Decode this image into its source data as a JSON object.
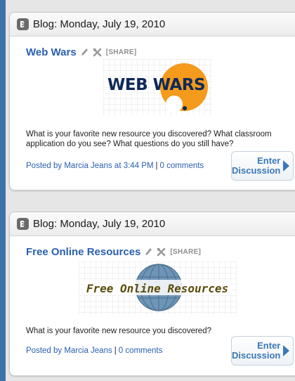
{
  "posts": [
    {
      "header": "Blog: Monday, July 19, 2010",
      "title": "Web Wars",
      "share_label": "[SHARE]",
      "logo_text": "WEB WARS",
      "body": "What is your favorite new resource you discovered? What classroom application do you see? What questions do you still have?",
      "footer": {
        "posted_by": "Posted by Marcia Jeans at 3:44 PM",
        "comments": "0 comments"
      },
      "button": {
        "line1": "Enter",
        "line2": "Discussion"
      }
    },
    {
      "header": "Blog: Monday, July 19, 2010",
      "title": "Free Online Resources",
      "share_label": "[SHARE]",
      "logo_text": "Free Online Resources",
      "body": "What is your favorite new resource you discovered?",
      "footer": {
        "posted_by": "Posted by Marcia Jeans",
        "comments": "0 comments"
      },
      "button": {
        "line1": "Enter",
        "line2": "Discussion"
      }
    }
  ],
  "colors": {
    "background": "#3c73a8",
    "link": "#2a5fb0",
    "logo_orange": "#f49a1c",
    "logo_navy": "#0e2a58",
    "globe_blue": "#6f95b6",
    "resources_text": "#5b4b0c"
  },
  "icons": [
    "blogger-icon",
    "pencil-icon",
    "tools-icon",
    "arrow-right-icon"
  ]
}
